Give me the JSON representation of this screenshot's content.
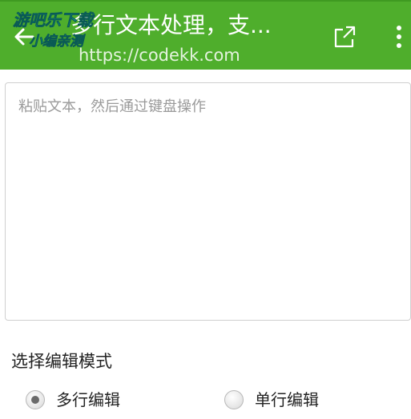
{
  "app_bar": {
    "title": "多行文本处理，支...",
    "subtitle": "https://codekk.com",
    "background_color": "#4fae2c",
    "back_icon": "arrow-left-icon",
    "share_icon": "share-icon",
    "more_icon": "more-vert-icon"
  },
  "watermark": {
    "line1": "游吧乐下载",
    "line2": "小编亲测",
    "color": "#19d4c8"
  },
  "editor": {
    "placeholder": "粘贴文本，然后通过键盘操作",
    "value": ""
  },
  "edit_mode": {
    "label": "选择编辑模式",
    "options": [
      {
        "label": "多行编辑",
        "selected": true
      },
      {
        "label": "单行编辑",
        "selected": false
      }
    ]
  }
}
